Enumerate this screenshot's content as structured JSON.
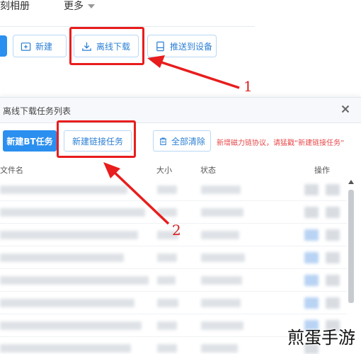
{
  "topnav": {
    "album": "刻相册",
    "more": "更多"
  },
  "toolbar": {
    "new": "新建",
    "offline": "离线下载",
    "push": "推送到设备"
  },
  "dialog": {
    "title": "离线下载任务列表",
    "new_bt": "新建BT任务",
    "new_link": "新建链接任务",
    "clear_all": "全部清除",
    "hint": "新增磁力链协议，请猛戳“新建链接任务”",
    "columns": {
      "name": "文件名",
      "size": "大小",
      "status": "状态",
      "ops": "操作"
    }
  },
  "annotations": {
    "step1": "1",
    "step2": "2"
  },
  "watermark": "煎蛋手游",
  "colors": {
    "accent": "#2b8ff0",
    "highlight": "#e81d1d"
  },
  "icons": {
    "new": "folder-plus-icon",
    "offline": "download-icon",
    "push": "device-icon",
    "clear": "trash-icon",
    "close": "close-icon"
  }
}
